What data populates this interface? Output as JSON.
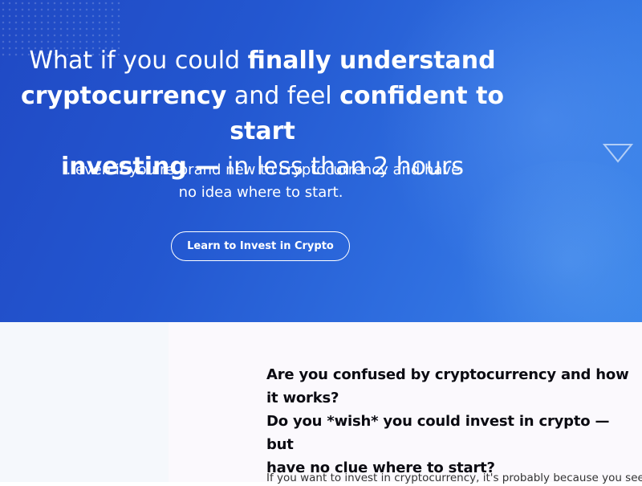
{
  "hero": {
    "headline": {
      "line1_regular": "What if you could ",
      "line1_bold": "finally understand",
      "line2_bold_a": "cryptocurrency",
      "line2_regular": " and feel ",
      "line2_bold_b": "confident to start",
      "line3_bold": "investing —",
      "line3_regular": " in less than 2 hours"
    },
    "subhead_line1": "...even if you're brand new to cryptocurrency and have",
    "subhead_line2": "no idea where to start.",
    "cta_label": "Learn to Invest in Crypto",
    "decor_icon": "triangle-down-outline-icon"
  },
  "intro": {
    "question_line1": "Are you confused by cryptocurrency and how",
    "question_line2": "it works?",
    "question_line3": "Do you *wish* you could invest in crypto — but",
    "question_line4": "have no clue where to start?",
    "body_partial": "If you want to invest in cryptocurrency, it's probably because you see"
  },
  "colors": {
    "hero_start": "#2049c4",
    "hero_end": "#3b86ea",
    "text_light": "#ffffff",
    "text_dark": "#0b0b12"
  }
}
